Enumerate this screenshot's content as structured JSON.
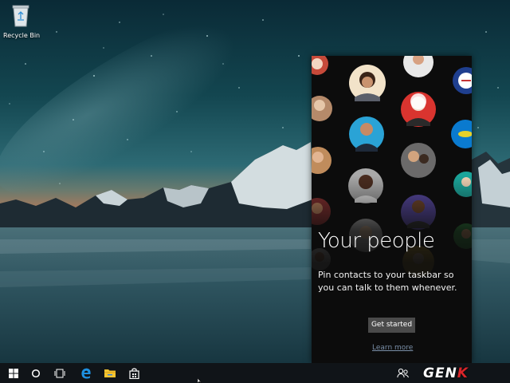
{
  "desktop": {
    "recycle_bin_label": "Recycle Bin",
    "recycle_bin_icon": "recycle-bin-icon"
  },
  "people_flyout": {
    "title": "Your people",
    "description": "Pin contacts to your taskbar so you can talk to them whenever.",
    "get_started_label": "Get started",
    "learn_more_label": "Learn more"
  },
  "taskbar": {
    "buttons": [
      {
        "name": "start-button",
        "icon": "windows-logo-icon"
      },
      {
        "name": "cortana-search-button",
        "icon": "cortana-circle-icon"
      },
      {
        "name": "task-view-button",
        "icon": "task-view-icon"
      },
      {
        "name": "edge-browser-button",
        "icon": "edge-icon"
      },
      {
        "name": "file-explorer-button",
        "icon": "folder-icon"
      },
      {
        "name": "store-button",
        "icon": "store-bag-icon"
      }
    ],
    "tray": {
      "people_icon": "people-icon"
    }
  },
  "watermark": {
    "text_start": "GEN",
    "text_end": "K"
  },
  "colors": {
    "taskbar_bg": "#101418",
    "flyout_bg": "#0c0c0c",
    "button_bg": "#4a4a4a",
    "edge_blue": "#1e90e0",
    "folder_yellow": "#f4c430",
    "watermark_red": "#d9252a"
  }
}
